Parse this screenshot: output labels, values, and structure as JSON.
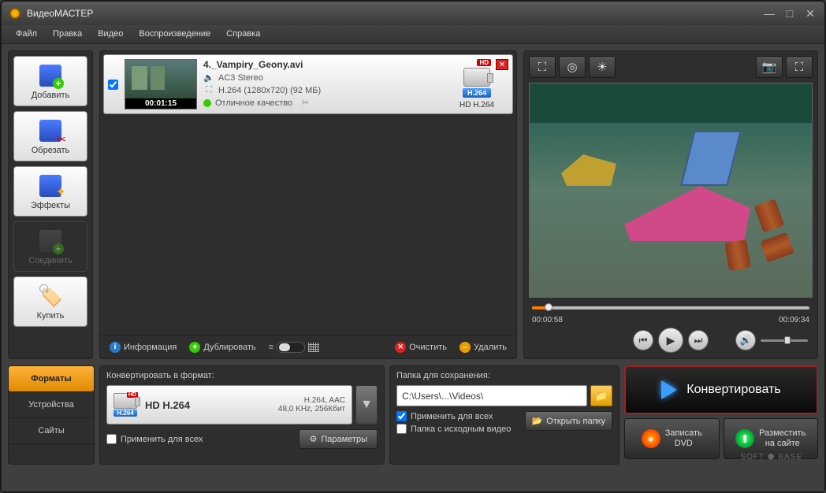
{
  "title": "ВидеоМАСТЕР",
  "menu": {
    "file": "Файл",
    "edit": "Правка",
    "video": "Видео",
    "playback": "Воспроизведение",
    "help": "Справка"
  },
  "sidebar": {
    "add": "Добавить",
    "cut": "Обрезать",
    "effects": "Эффекты",
    "join": "Соединить",
    "buy": "Купить"
  },
  "video_item": {
    "name": "4._Vampiry_Geony.avi",
    "audio": "AC3 Stereo",
    "codec": "H.264 (1280x720) (92 МБ)",
    "quality": "Отличное качество",
    "duration": "00:01:15",
    "hd": "HD",
    "badge": "H.264",
    "target": "HD H.264"
  },
  "toolbar": {
    "info": "Информация",
    "dup": "Дублировать",
    "clear": "Очистить",
    "delete": "Удалить"
  },
  "preview": {
    "current": "00:00:58",
    "total": "00:09:34"
  },
  "tabs": {
    "formats": "Форматы",
    "devices": "Устройства",
    "sites": "Сайты"
  },
  "format": {
    "label": "Конвертировать в формат:",
    "name": "HD H.264",
    "spec1": "H.264, AAC",
    "spec2": "48,0 KHz, 256Кбит",
    "badge": "H.264",
    "hd": "HD",
    "apply_all": "Применить для всех",
    "params": "Параметры"
  },
  "save": {
    "label": "Папка для сохранения:",
    "path": "C:\\Users\\...\\Videos\\",
    "apply_all": "Применить для всех",
    "src_folder": "Папка с исходным видео",
    "open": "Открыть папку"
  },
  "actions": {
    "convert": "Конвертировать",
    "dvd": "Записать\nDVD",
    "web": "Разместить\nна сайте"
  },
  "watermark": "SOFT ⬢ BASE"
}
